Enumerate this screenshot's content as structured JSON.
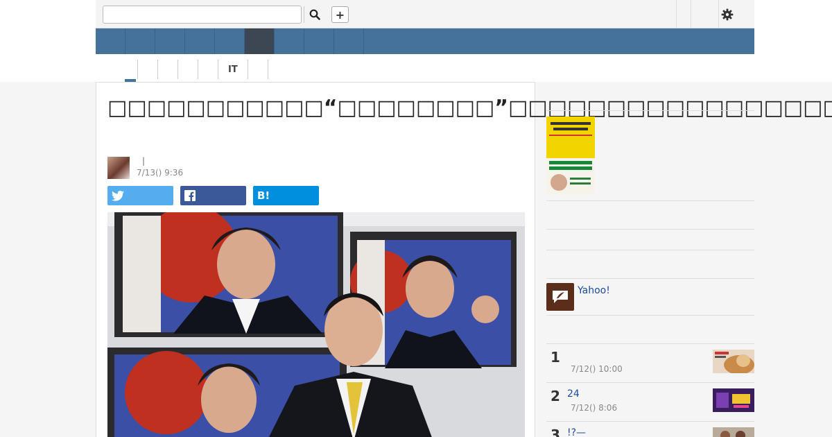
{
  "header": {
    "search_placeholder": "",
    "search_icon": "magnifier-icon",
    "plus_label": "+",
    "settings_icon": "gear-icon"
  },
  "nav": {
    "tabs": [
      "",
      "",
      "",
      "",
      "",
      "",
      "",
      "",
      ""
    ],
    "active_index": 5
  },
  "subnav": {
    "items": [
      "",
      "",
      "",
      "",
      "",
      "IT",
      "",
      ""
    ],
    "active_index": 0
  },
  "article": {
    "title": "□□□□□□□□□□□“□□□□□□□□”□□□□□□□□□□□□□□□□□□",
    "author_separator": "|",
    "date": "7/13() 9:36",
    "share_buttons": [
      {
        "name": "twitter",
        "icon": "twitter-icon",
        "label": ""
      },
      {
        "name": "facebook",
        "icon": "facebook-icon",
        "label": ""
      },
      {
        "name": "hatena",
        "icon": "hatena-bookmark-icon",
        "label": "B!"
      }
    ]
  },
  "sidebar": {
    "yahoo_label": "Yahoo!",
    "ranking": [
      {
        "rank": "1",
        "title": "",
        "date": "7/12() 10:00"
      },
      {
        "rank": "2",
        "title": "24",
        "date": "7/12() 8:06"
      },
      {
        "rank": "3",
        "title": "!?—",
        "date": ""
      }
    ]
  },
  "colors": {
    "nav": "#44729b",
    "nav_active": "#3d4653",
    "twitter": "#55acee",
    "facebook": "#3b5998",
    "hatena": "#008fde",
    "link": "#1a4a9c"
  }
}
